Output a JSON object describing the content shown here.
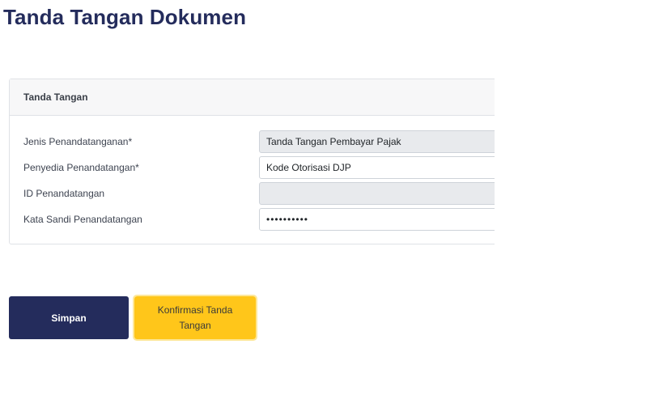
{
  "page": {
    "title": "Tanda Tangan Dokumen"
  },
  "card": {
    "header": "Tanda Tangan",
    "fields": [
      {
        "label": "Jenis Penandatanganan*",
        "value": "Tanda Tangan Pembayar Pajak",
        "readonly": true
      },
      {
        "label": "Penyedia Penandatangan*",
        "value": "Kode Otorisasi DJP",
        "readonly": false
      },
      {
        "label": "ID Penandatangan",
        "value": "",
        "readonly": true
      },
      {
        "label": "Kata Sandi Penandatangan",
        "value": "••••••••••",
        "readonly": false
      }
    ]
  },
  "buttons": {
    "save": "Simpan",
    "confirm": "Konfirmasi Tanda Tangan"
  },
  "colors": {
    "primary": "#242c5c",
    "accent": "#ffc61a"
  }
}
